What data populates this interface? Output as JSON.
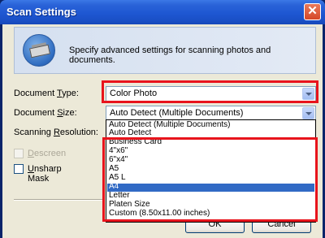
{
  "window": {
    "title": "Scan Settings",
    "close_label": "✕"
  },
  "header": {
    "description": "Specify advanced settings for scanning photos and documents."
  },
  "document_type": {
    "label_pre": "Document ",
    "label_key": "T",
    "label_post": "ype:",
    "value": "Color Photo"
  },
  "document_size": {
    "label_pre": "Document ",
    "label_key": "S",
    "label_post": "ize:",
    "value": "Auto Detect (Multiple Documents)",
    "options": [
      "Auto Detect (Multiple Documents)",
      "Auto Detect",
      "Business Card",
      "4\"x6\"",
      "6\"x4\"",
      "A5",
      "A5 L",
      "A4",
      "Letter",
      "Platen Size",
      "Custom (8.50x11.00 inches)"
    ],
    "highlighted_option": "A4"
  },
  "scanning_resolution": {
    "label_pre": "Scanning ",
    "label_key": "R",
    "label_post": "esolution:"
  },
  "descreen": {
    "label_key": "D",
    "label_post": "escreen"
  },
  "unsharp_mask": {
    "label_key": "U",
    "label_post": "nsharp Mask"
  },
  "buttons": {
    "ok": "OK",
    "cancel": "Cancel"
  },
  "colors": {
    "annotation_red": "#e8141c",
    "selection_blue": "#316ac5",
    "title_bar_blue": "#1e57d2"
  }
}
